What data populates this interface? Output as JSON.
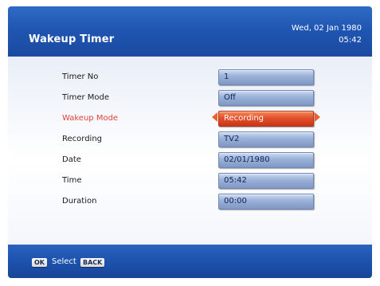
{
  "header": {
    "title": "Wakeup Timer",
    "date": "Wed, 02 Jan 1980",
    "time": "05:42"
  },
  "rows": [
    {
      "label": "Timer No",
      "value": "1",
      "active": false
    },
    {
      "label": "Timer Mode",
      "value": "Off",
      "active": false
    },
    {
      "label": "Wakeup Mode",
      "value": "Recording",
      "active": true
    },
    {
      "label": "Recording",
      "value": "TV2",
      "active": false
    },
    {
      "label": "Date",
      "value": "02/01/1980",
      "active": false
    },
    {
      "label": "Time",
      "value": "05:42",
      "active": false
    },
    {
      "label": "Duration",
      "value": "00:00",
      "active": false
    }
  ],
  "footer": {
    "ok_key": "OK",
    "select_label": "Select",
    "back_key": "BACK"
  },
  "colors": {
    "header_blue": "#1f56b3",
    "active_red": "#e2512b",
    "field_blue": "#9cb3d9"
  }
}
